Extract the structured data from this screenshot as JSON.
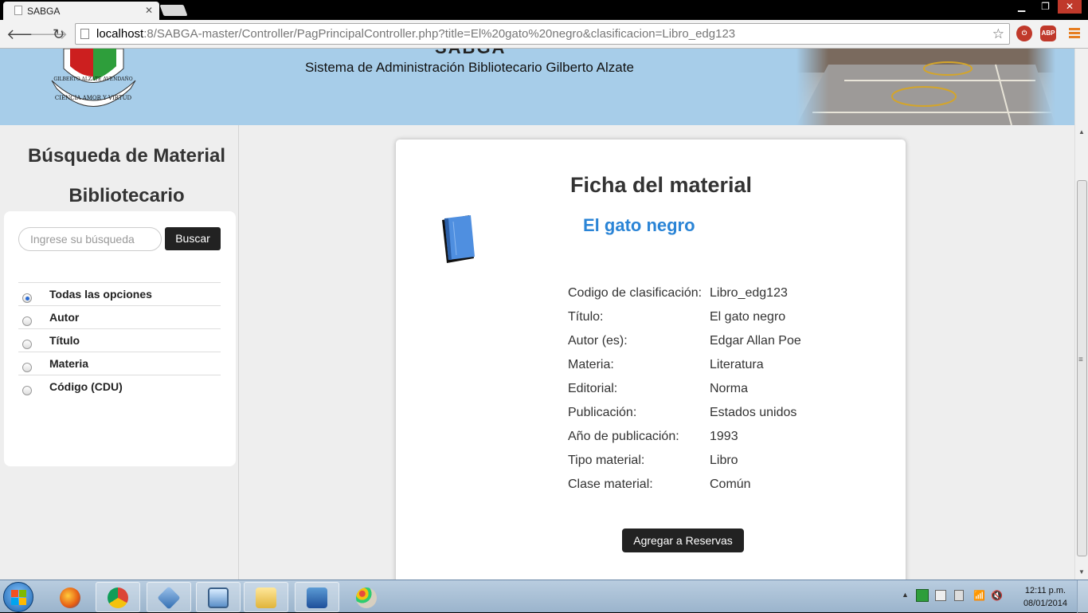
{
  "browser": {
    "tab_title": "SABGA",
    "url_host": "localhost",
    "url_rest": ":8/SABGA-master/Controller/PagPrincipalController.php?title=El%20gato%20negro&clasificacion=Libro_edg123",
    "ext_abp": "ABP"
  },
  "header": {
    "app_name": "SABGA",
    "subtitle": "Sistema de Administración Bibliotecario Gilberto Alzate",
    "logo_text_top": "GILBERTO ALZATE AVENDAÑO",
    "logo_text_bottom": "CIENCIA AMOR Y VIRTUD"
  },
  "sidebar": {
    "title_line1": "Búsqueda de Material",
    "title_line2": "Bibliotecario",
    "search_placeholder": "Ingrese su búsqueda",
    "search_button": "Buscar",
    "options": [
      {
        "label": "Todas las opciones",
        "checked": true
      },
      {
        "label": "Autor",
        "checked": false
      },
      {
        "label": "Título",
        "checked": false
      },
      {
        "label": "Materia",
        "checked": false
      },
      {
        "label": "Código (CDU)",
        "checked": false
      }
    ]
  },
  "card": {
    "heading": "Ficha del material",
    "book_title": "El gato negro",
    "fields": [
      {
        "key": "Codigo de clasificación:",
        "value": "Libro_edg123"
      },
      {
        "key": "Título:",
        "value": "El gato negro"
      },
      {
        "key": "Autor (es):",
        "value": "Edgar Allan Poe"
      },
      {
        "key": "Materia:",
        "value": "Literatura"
      },
      {
        "key": "Editorial:",
        "value": "Norma"
      },
      {
        "key": "Publicación:",
        "value": "Estados unidos"
      },
      {
        "key": "Año de publicación:",
        "value": "1993"
      },
      {
        "key": "Tipo material:",
        "value": "Libro"
      },
      {
        "key": "Clase material:",
        "value": "Común"
      }
    ],
    "reserve_button": "Agregar a Reservas"
  },
  "taskbar": {
    "apps": [
      "firefox-icon",
      "chrome-icon",
      "virtualbox-icon",
      "remote-desktop-icon",
      "file-explorer-icon",
      "word-icon",
      "paint-icon"
    ],
    "time": "12:11 p.m.",
    "date": "08/01/2014"
  },
  "colors": {
    "header_bg": "#a7cde9",
    "book_title": "#2a84d6",
    "button_dark": "#222222"
  }
}
